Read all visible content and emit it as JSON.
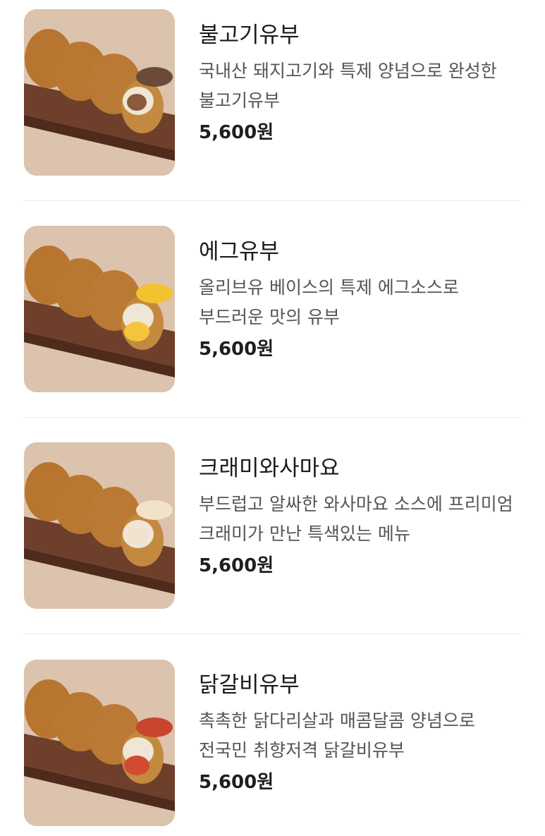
{
  "menu": {
    "items": [
      {
        "name": "불고기유부",
        "description": "국내산 돼지고기와 특제 양념으로 완성한 불고기유부",
        "price": "5,600원",
        "filling_top_color": "#6b4a3a",
        "filling_side_color": "#8a5a3e"
      },
      {
        "name": "에그유부",
        "description": "올리브유 베이스의 특제 에그소스로 부드러운 맛의 유부",
        "price": "5,600원",
        "filling_top_color": "#f2c230",
        "filling_side_color": "#f4c53a"
      },
      {
        "name": "크래미와사마요",
        "description": "부드럽고 알싸한 와사마요 소스에 프리미엄 크래미가 만난 특색있는 메뉴",
        "price": "5,600원",
        "filling_top_color": "#f1e2c8",
        "filling_side_color": "#efe3cf"
      },
      {
        "name": "닭갈비유부",
        "description": "촉촉한 닭다리살과 매콤달콤 양념으로 전국민 취향저격 닭갈비유부",
        "price": "5,600원",
        "filling_top_color": "#c8452e",
        "filling_side_color": "#d24a32"
      }
    ]
  }
}
